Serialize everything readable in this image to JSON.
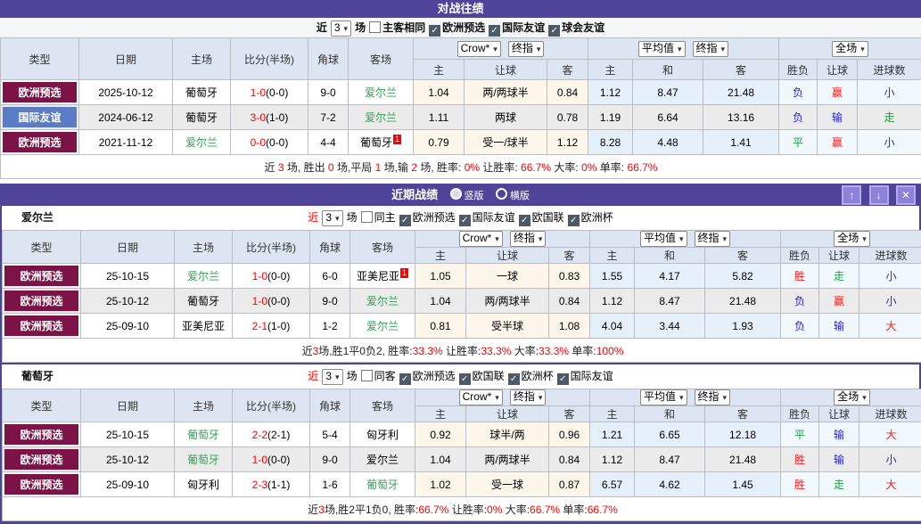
{
  "colors": {
    "accent_purple": "#4f4499",
    "button_purple": "#8d82da",
    "maroon_badge": "#7b1347",
    "blue_badge": "#5b7cc4",
    "team_green": "#35a057",
    "score_red": "#ff0000",
    "result_blue": "#2323dd",
    "result_green": "#18a53c",
    "header_bg": "#dce5f1"
  },
  "icons": {
    "up": "↑",
    "down": "↓",
    "close": "✕"
  },
  "thead": {
    "type": "类型",
    "date": "日期",
    "home": "主场",
    "score": "比分(半场)",
    "corners": "角球",
    "away": "客场",
    "h": "主",
    "handicap": "让球",
    "a": "客",
    "d": "和",
    "wdl": "胜负",
    "goals": "进球数",
    "crow": "Crow*",
    "final": "终指",
    "avg": "平均值",
    "full": "全场"
  },
  "h2h": {
    "title": "对战往绩",
    "filter": {
      "near": "近",
      "near_red": false,
      "count": "3",
      "games": "场",
      "uncheck": "主客相同",
      "checks": [
        "欧洲预选",
        "国际友谊",
        "球会友谊"
      ]
    },
    "rows": [
      {
        "league": "欧洲预选",
        "league_style": "maroon",
        "date": "2025-10-12",
        "home": {
          "name": "葡萄牙",
          "focus": false,
          "sup": ""
        },
        "score": "1-0",
        "half": "(0-0)",
        "corners": "9-0",
        "away": {
          "name": "爱尔兰",
          "focus": true,
          "sup": ""
        },
        "crow": [
          "1.04",
          "两/两球半",
          "0.84"
        ],
        "avg": [
          "1.12",
          "8.47",
          "21.48"
        ],
        "result": [
          {
            "text": "负",
            "color": "blue"
          },
          {
            "text": "赢",
            "color": "red"
          },
          {
            "text": "小",
            "color": "blue"
          }
        ]
      },
      {
        "league": "国际友谊",
        "league_style": "blue",
        "date": "2024-06-12",
        "home": {
          "name": "葡萄牙",
          "focus": false,
          "sup": ""
        },
        "score": "3-0",
        "half": "(1-0)",
        "corners": "7-2",
        "away": {
          "name": "爱尔兰",
          "focus": true,
          "sup": ""
        },
        "crow": [
          "1.11",
          "两球",
          "0.78"
        ],
        "avg": [
          "1.19",
          "6.64",
          "13.16"
        ],
        "result": [
          {
            "text": "负",
            "color": "blue"
          },
          {
            "text": "输",
            "color": "blue"
          },
          {
            "text": "走",
            "color": "green"
          }
        ]
      },
      {
        "league": "欧洲预选",
        "league_style": "maroon",
        "date": "2021-11-12",
        "home": {
          "name": "爱尔兰",
          "focus": true,
          "sup": ""
        },
        "score": "0-0",
        "half": "(0-0)",
        "corners": "4-4",
        "away": {
          "name": "葡萄牙",
          "focus": false,
          "sup": "1"
        },
        "crow": [
          "0.79",
          "受一/球半",
          "1.12"
        ],
        "avg": [
          "8.28",
          "4.48",
          "1.41"
        ],
        "result": [
          {
            "text": "平",
            "color": "green"
          },
          {
            "text": "赢",
            "color": "red"
          },
          {
            "text": "小",
            "color": "blue"
          }
        ]
      }
    ],
    "summary": [
      {
        "text": "近 "
      },
      {
        "text": "3",
        "red": true
      },
      {
        "text": " 场, 胜出 "
      },
      {
        "text": "0",
        "red": true
      },
      {
        "text": " 场,平局 "
      },
      {
        "text": "1",
        "red": true
      },
      {
        "text": " 场,输 "
      },
      {
        "text": "2",
        "red": true
      },
      {
        "text": " 场, 胜率: "
      },
      {
        "text": "0%",
        "red": true
      },
      {
        "text": " 让胜率: "
      },
      {
        "text": "66.7%",
        "red": true
      },
      {
        "text": " 大率: "
      },
      {
        "text": "0%",
        "red": true
      },
      {
        "text": " 单率: "
      },
      {
        "text": "66.7%",
        "red": true
      }
    ]
  },
  "recent": {
    "title": "近期战绩",
    "view_vertical": "竖版",
    "view_horizontal": "横版",
    "teams": [
      {
        "name": "爱尔兰",
        "filter": {
          "near": "近",
          "near_red": true,
          "count": "3",
          "games": "场",
          "uncheck": "同主",
          "checks": [
            "欧洲预选",
            "国际友谊",
            "欧国联",
            "欧洲杯"
          ]
        },
        "rows": [
          {
            "league": "欧洲预选",
            "league_style": "maroon",
            "date": "25-10-15",
            "home": {
              "name": "爱尔兰",
              "focus": true,
              "sup": ""
            },
            "score": "1-0",
            "half": "(0-0)",
            "corners": "6-0",
            "away": {
              "name": "亚美尼亚",
              "focus": false,
              "sup": "1"
            },
            "crow": [
              "1.05",
              "一球",
              "0.83"
            ],
            "avg": [
              "1.55",
              "4.17",
              "5.82"
            ],
            "result": [
              {
                "text": "胜",
                "color": "red"
              },
              {
                "text": "走",
                "color": "green"
              },
              {
                "text": "小",
                "color": "blue"
              }
            ]
          },
          {
            "league": "欧洲预选",
            "league_style": "maroon",
            "date": "25-10-12",
            "home": {
              "name": "葡萄牙",
              "focus": false,
              "sup": ""
            },
            "score": "1-0",
            "half": "(0-0)",
            "corners": "9-0",
            "away": {
              "name": "爱尔兰",
              "focus": true,
              "sup": ""
            },
            "crow": [
              "1.04",
              "两/两球半",
              "0.84"
            ],
            "avg": [
              "1.12",
              "8.47",
              "21.48"
            ],
            "result": [
              {
                "text": "负",
                "color": "blue"
              },
              {
                "text": "赢",
                "color": "red"
              },
              {
                "text": "小",
                "color": "blue"
              }
            ]
          },
          {
            "league": "欧洲预选",
            "league_style": "maroon",
            "date": "25-09-10",
            "home": {
              "name": "亚美尼亚",
              "focus": false,
              "sup": ""
            },
            "score": "2-1",
            "half": "(1-0)",
            "corners": "1-2",
            "away": {
              "name": "爱尔兰",
              "focus": true,
              "sup": ""
            },
            "crow": [
              "0.81",
              "受半球",
              "1.08"
            ],
            "avg": [
              "4.04",
              "3.44",
              "1.93"
            ],
            "result": [
              {
                "text": "负",
                "color": "blue"
              },
              {
                "text": "输",
                "color": "blue"
              },
              {
                "text": "大",
                "color": "red"
              }
            ]
          }
        ],
        "summary": [
          {
            "text": "近"
          },
          {
            "text": "3",
            "red": true
          },
          {
            "text": "场,胜1平0负2, 胜率:"
          },
          {
            "text": "33.3%",
            "red": true
          },
          {
            "text": " 让胜率:"
          },
          {
            "text": "33.3%",
            "red": true
          },
          {
            "text": " 大率:"
          },
          {
            "text": "33.3%",
            "red": true
          },
          {
            "text": " 单率:"
          },
          {
            "text": "100%",
            "red": true
          }
        ]
      },
      {
        "name": "葡萄牙",
        "filter": {
          "near": "近",
          "near_red": true,
          "count": "3",
          "games": "场",
          "uncheck": "同客",
          "checks": [
            "欧洲预选",
            "欧国联",
            "欧洲杯",
            "国际友谊"
          ]
        },
        "rows": [
          {
            "league": "欧洲预选",
            "league_style": "maroon",
            "date": "25-10-15",
            "home": {
              "name": "葡萄牙",
              "focus": true,
              "sup": ""
            },
            "score": "2-2",
            "half": "(2-1)",
            "corners": "5-4",
            "away": {
              "name": "匈牙利",
              "focus": false,
              "sup": ""
            },
            "crow": [
              "0.92",
              "球半/两",
              "0.96"
            ],
            "avg": [
              "1.21",
              "6.65",
              "12.18"
            ],
            "result": [
              {
                "text": "平",
                "color": "green"
              },
              {
                "text": "输",
                "color": "blue"
              },
              {
                "text": "大",
                "color": "red"
              }
            ]
          },
          {
            "league": "欧洲预选",
            "league_style": "maroon",
            "date": "25-10-12",
            "home": {
              "name": "葡萄牙",
              "focus": true,
              "sup": ""
            },
            "score": "1-0",
            "half": "(0-0)",
            "corners": "9-0",
            "away": {
              "name": "爱尔兰",
              "focus": false,
              "sup": ""
            },
            "crow": [
              "1.04",
              "两/两球半",
              "0.84"
            ],
            "avg": [
              "1.12",
              "8.47",
              "21.48"
            ],
            "result": [
              {
                "text": "胜",
                "color": "red"
              },
              {
                "text": "输",
                "color": "blue"
              },
              {
                "text": "小",
                "color": "blue"
              }
            ]
          },
          {
            "league": "欧洲预选",
            "league_style": "maroon",
            "date": "25-09-10",
            "home": {
              "name": "匈牙利",
              "focus": false,
              "sup": ""
            },
            "score": "2-3",
            "half": "(1-1)",
            "corners": "1-6",
            "away": {
              "name": "葡萄牙",
              "focus": true,
              "sup": ""
            },
            "crow": [
              "1.02",
              "受一球",
              "0.87"
            ],
            "avg": [
              "6.57",
              "4.62",
              "1.45"
            ],
            "result": [
              {
                "text": "胜",
                "color": "red"
              },
              {
                "text": "走",
                "color": "green"
              },
              {
                "text": "大",
                "color": "red"
              }
            ]
          }
        ],
        "summary": [
          {
            "text": "近"
          },
          {
            "text": "3",
            "red": true
          },
          {
            "text": "场,胜2平1负0, 胜率:"
          },
          {
            "text": "66.7%",
            "red": true
          },
          {
            "text": " 让胜率:"
          },
          {
            "text": "0%",
            "red": true
          },
          {
            "text": " 大率:"
          },
          {
            "text": "66.7%",
            "red": true
          },
          {
            "text": " 单率:"
          },
          {
            "text": "66.7%",
            "red": true
          }
        ]
      }
    ]
  }
}
